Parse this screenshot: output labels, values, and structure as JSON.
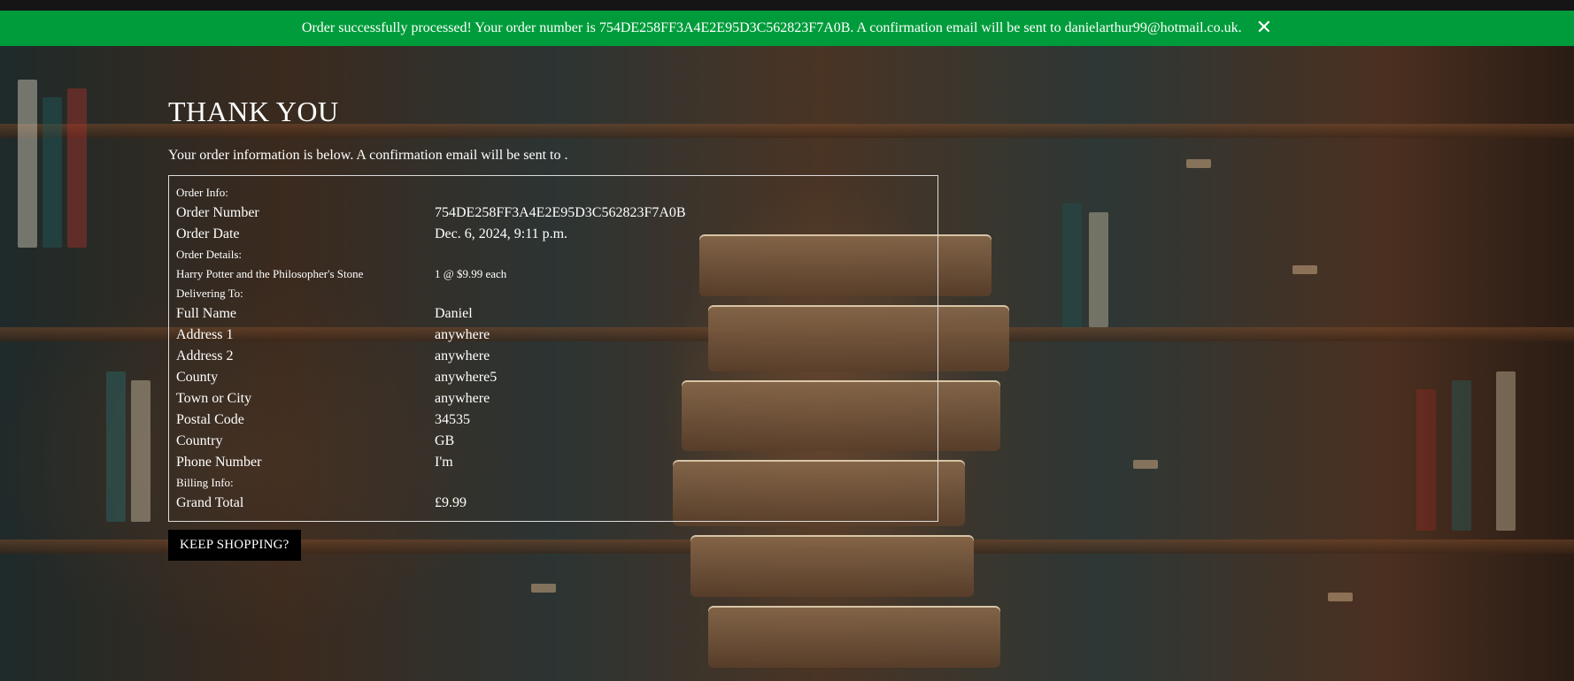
{
  "banner": {
    "message": "Order successfully processed! Your order number is 754DE258FF3A4E2E95D3C562823F7A0B. A confirmation email will be sent to danielarthur99@hotmail.co.uk.",
    "close_icon": "close-icon",
    "close_glyph": "✕",
    "color": "#009c3b"
  },
  "page": {
    "title": "THANK YOU",
    "intro": "Your order information is below. A confirmation email will be sent to ."
  },
  "order_info": {
    "heading": "Order Info:",
    "order_number_label": "Order Number",
    "order_number": "754DE258FF3A4E2E95D3C562823F7A0B",
    "order_date_label": "Order Date",
    "order_date": "Dec. 6, 2024, 9:11 p.m."
  },
  "order_details": {
    "heading": "Order Details:",
    "items": [
      {
        "title": "Harry Potter and the Philosopher's Stone",
        "qty_price": "1 @ $9.99 each"
      }
    ]
  },
  "delivering_to": {
    "heading": "Delivering To:",
    "fields": [
      {
        "label": "Full Name",
        "value": "Daniel"
      },
      {
        "label": "Address 1",
        "value": "anywhere"
      },
      {
        "label": "Address 2",
        "value": "anywhere"
      },
      {
        "label": "County",
        "value": "anywhere5"
      },
      {
        "label": "Town or City",
        "value": "anywhere"
      },
      {
        "label": "Postal Code",
        "value": "34535"
      },
      {
        "label": "Country",
        "value": "GB"
      },
      {
        "label": "Phone Number",
        "value": "I'm"
      }
    ]
  },
  "billing_info": {
    "heading": "Billing Info:",
    "grand_total_label": "Grand Total",
    "grand_total": "£9.99"
  },
  "actions": {
    "keep_shopping_label": "KEEP SHOPPING?"
  }
}
